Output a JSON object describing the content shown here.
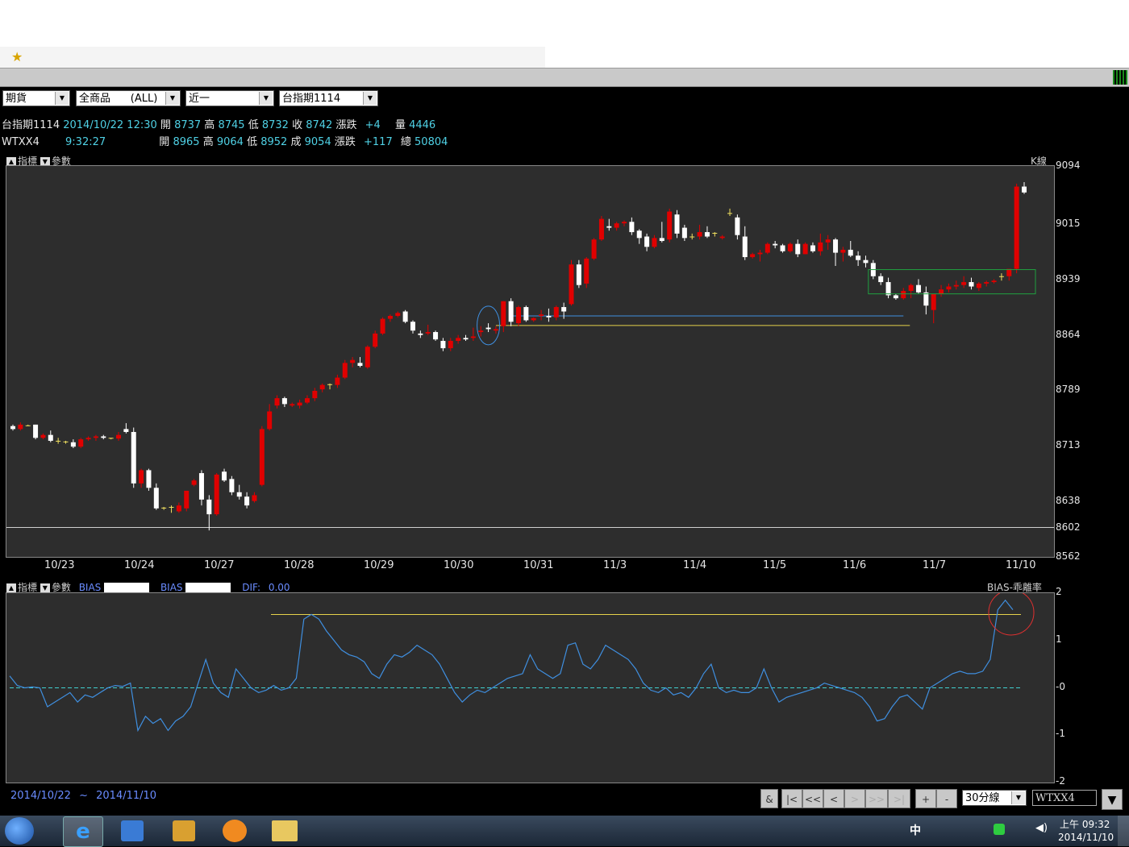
{
  "filters": {
    "market": "期貨",
    "products": "全商品      (ALL)",
    "period": "近一",
    "contract": "台指期1114"
  },
  "quote1": {
    "name": "台指期1114",
    "datetime": "2014/10/22 12:30",
    "open_lbl": "開",
    "open": "8737",
    "high_lbl": "高",
    "high": "8745",
    "low_lbl": "低",
    "low": "8732",
    "close_lbl": "收",
    "close": "8742",
    "chg_lbl": "漲跌",
    "chg": "+4",
    "vol_lbl": "量",
    "vol": "4446"
  },
  "quote2": {
    "name": "WTXX4",
    "time": "9:32:27",
    "open_lbl": "開",
    "open": "8965",
    "high_lbl": "高",
    "high": "9064",
    "low_lbl": "低",
    "low": "8952",
    "close_lbl": "成",
    "close": "9054",
    "chg_lbl": "漲跌",
    "chg": "+117",
    "vol_lbl": "總",
    "vol": "50804"
  },
  "main_panel": {
    "indicator_label": "指標",
    "param_label": "參數",
    "chart_label": "K線"
  },
  "bias_panel": {
    "indicator_label": "指標",
    "param_label": "參數",
    "bias_label1": "BIAS",
    "bias_label2": "BIAS",
    "dif_label": "DIF:",
    "dif_value": "0.00",
    "chart_label": "BIAS-乖離率"
  },
  "footer": {
    "range_start": "2014/10/22",
    "range_sep": "~",
    "range_end": "2014/11/10",
    "btn_amp": "&",
    "btn_first": "|<",
    "btn_prev_page": "<<",
    "btn_prev": "<",
    "btn_next": ">",
    "btn_next_page": ">>",
    "btn_last": ">|",
    "btn_plus": "+",
    "btn_minus": "-",
    "interval": "30分線",
    "symbol": "WTXX4"
  },
  "taskbar": {
    "clock_time": "上午 09:32",
    "clock_date": "2014/11/10",
    "ime": "中"
  },
  "colors": {
    "up": "#e00000",
    "down": "#ffffff",
    "flat": "#f0e060",
    "bias": "#3f8fe0",
    "zero": "#40d0d0",
    "refline": "#e6d24a",
    "blue_support": "#3f8fe0",
    "green_box": "#20a040",
    "red_circle": "#e03030"
  },
  "chart_data": [
    {
      "type": "candlestick",
      "title": "K線",
      "x_labels": [
        "10/23",
        "10/24",
        "10/27",
        "10/28",
        "10/29",
        "10/30",
        "10/31",
        "11/3",
        "11/4",
        "11/5",
        "11/6",
        "11/7",
        "11/10"
      ],
      "y_ticks": [
        9094,
        9015,
        8939,
        8864,
        8789,
        8713,
        8638,
        8602,
        8562
      ],
      "ylim": [
        8562,
        9094
      ],
      "horizontal_line": 8602,
      "ohlc": [
        [
          8740,
          8742,
          8734,
          8736
        ],
        [
          8736,
          8745,
          8734,
          8742
        ],
        [
          8740,
          8742,
          8740,
          8741
        ],
        [
          8742,
          8742,
          8722,
          8724
        ],
        [
          8724,
          8730,
          8722,
          8728
        ],
        [
          8728,
          8734,
          8718,
          8720
        ],
        [
          8720,
          8724,
          8716,
          8719
        ],
        [
          8719,
          8720,
          8716,
          8718
        ],
        [
          8718,
          8722,
          8710,
          8712
        ],
        [
          8712,
          8724,
          8710,
          8722
        ],
        [
          8722,
          8726,
          8720,
          8724
        ],
        [
          8724,
          8728,
          8720,
          8726
        ],
        [
          8726,
          8728,
          8722,
          8724
        ],
        [
          8724,
          8724,
          8722,
          8723
        ],
        [
          8723,
          8732,
          8720,
          8728
        ],
        [
          8736,
          8744,
          8730,
          8732
        ],
        [
          8732,
          8738,
          8656,
          8662
        ],
        [
          8662,
          8682,
          8656,
          8680
        ],
        [
          8680,
          8682,
          8652,
          8656
        ],
        [
          8656,
          8662,
          8626,
          8628
        ],
        [
          8628,
          8630,
          8626,
          8629
        ],
        [
          8629,
          8632,
          8622,
          8630
        ],
        [
          8624,
          8636,
          8622,
          8632
        ],
        [
          8628,
          8652,
          8624,
          8652
        ],
        [
          8660,
          8668,
          8658,
          8666
        ],
        [
          8676,
          8680,
          8632,
          8640
        ],
        [
          8640,
          8646,
          8598,
          8620
        ],
        [
          8620,
          8676,
          8618,
          8674
        ],
        [
          8678,
          8682,
          8664,
          8666
        ],
        [
          8668,
          8672,
          8646,
          8650
        ],
        [
          8650,
          8660,
          8640,
          8644
        ],
        [
          8644,
          8650,
          8628,
          8632
        ],
        [
          8638,
          8650,
          8636,
          8646
        ],
        [
          8660,
          8740,
          8658,
          8736
        ],
        [
          8736,
          8770,
          8734,
          8760
        ],
        [
          8768,
          8782,
          8764,
          8778
        ],
        [
          8778,
          8780,
          8766,
          8770
        ],
        [
          8768,
          8772,
          8766,
          8770
        ],
        [
          8768,
          8776,
          8764,
          8772
        ],
        [
          8772,
          8782,
          8770,
          8778
        ],
        [
          8778,
          8792,
          8774,
          8788
        ],
        [
          8790,
          8798,
          8786,
          8796
        ],
        [
          8796,
          8798,
          8790,
          8797
        ],
        [
          8796,
          8810,
          8792,
          8806
        ],
        [
          8806,
          8830,
          8804,
          8826
        ],
        [
          8826,
          8834,
          8820,
          8830
        ],
        [
          8826,
          8834,
          8820,
          8822
        ],
        [
          8820,
          8850,
          8818,
          8848
        ],
        [
          8848,
          8870,
          8846,
          8866
        ],
        [
          8866,
          8888,
          8864,
          8886
        ],
        [
          8886,
          8892,
          8882,
          8890
        ],
        [
          8890,
          8896,
          8888,
          8894
        ],
        [
          8896,
          8898,
          8880,
          8882
        ],
        [
          8882,
          8884,
          8866,
          8870
        ],
        [
          8866,
          8870,
          8860,
          8864
        ],
        [
          8866,
          8878,
          8864,
          8868
        ],
        [
          8868,
          8870,
          8856,
          8858
        ],
        [
          8856,
          8860,
          8842,
          8846
        ],
        [
          8846,
          8860,
          8842,
          8856
        ],
        [
          8856,
          8864,
          8852,
          8860
        ],
        [
          8860,
          8864,
          8856,
          8858
        ],
        [
          8860,
          8874,
          8856,
          8862
        ],
        [
          8868,
          8876,
          8862,
          8870
        ],
        [
          8874,
          8880,
          8868,
          8872
        ],
        [
          8870,
          8876,
          8866,
          8872
        ],
        [
          8876,
          8910,
          8868,
          8910
        ],
        [
          8910,
          8914,
          8876,
          8882
        ],
        [
          8880,
          8904,
          8876,
          8902
        ],
        [
          8902,
          8904,
          8882,
          8884
        ],
        [
          8884,
          8888,
          8882,
          8887
        ],
        [
          8890,
          8898,
          8884,
          8892
        ],
        [
          8890,
          8900,
          8882,
          8888
        ],
        [
          8888,
          8904,
          8884,
          8902
        ],
        [
          8902,
          8908,
          8886,
          8896
        ],
        [
          8906,
          8966,
          8904,
          8960
        ],
        [
          8960,
          8966,
          8928,
          8932
        ],
        [
          8934,
          8970,
          8928,
          8968
        ],
        [
          8968,
          8996,
          8966,
          8994
        ],
        [
          8994,
          9026,
          8992,
          9022
        ],
        [
          9012,
          9022,
          9006,
          9010
        ],
        [
          9010,
          9018,
          9006,
          9016
        ],
        [
          9016,
          9020,
          9012,
          9018
        ],
        [
          9018,
          9024,
          9000,
          9004
        ],
        [
          9006,
          9008,
          8988,
          8996
        ],
        [
          8998,
          9002,
          8978,
          8984
        ],
        [
          8984,
          9000,
          8982,
          8996
        ],
        [
          8996,
          9018,
          8990,
          8992
        ],
        [
          8994,
          9036,
          8990,
          9032
        ],
        [
          9028,
          9034,
          8996,
          9002
        ],
        [
          9010,
          9014,
          8992,
          8996
        ],
        [
          8998,
          9002,
          8994,
          8998
        ],
        [
          8998,
          9014,
          8994,
          9004
        ],
        [
          9004,
          9012,
          8996,
          8998
        ],
        [
          9002,
          9004,
          8998,
          9003
        ],
        [
          8996,
          9000,
          8994,
          8998
        ],
        [
          9030,
          9036,
          9026,
          9030
        ],
        [
          9024,
          9028,
          8994,
          9000
        ],
        [
          8998,
          9012,
          8966,
          8970
        ],
        [
          8970,
          8976,
          8968,
          8974
        ],
        [
          8974,
          8980,
          8964,
          8976
        ],
        [
          8976,
          8990,
          8974,
          8988
        ],
        [
          8988,
          8992,
          8982,
          8986
        ],
        [
          8986,
          8988,
          8976,
          8978
        ],
        [
          8978,
          8990,
          8976,
          8988
        ],
        [
          8988,
          8994,
          8970,
          8974
        ],
        [
          8974,
          8990,
          8974,
          8988
        ],
        [
          8986,
          8990,
          8976,
          8978
        ],
        [
          8978,
          9002,
          8972,
          8990
        ],
        [
          8990,
          9000,
          8980,
          8994
        ],
        [
          8994,
          8996,
          8958,
          8976
        ],
        [
          8976,
          8984,
          8964,
          8980
        ],
        [
          8980,
          8992,
          8970,
          8972
        ],
        [
          8972,
          8978,
          8958,
          8966
        ],
        [
          8966,
          8972,
          8956,
          8962
        ],
        [
          8962,
          8966,
          8940,
          8944
        ],
        [
          8944,
          8948,
          8932,
          8936
        ],
        [
          8936,
          8942,
          8914,
          8918
        ],
        [
          8918,
          8920,
          8912,
          8914
        ],
        [
          8914,
          8928,
          8912,
          8924
        ],
        [
          8924,
          8934,
          8914,
          8932
        ],
        [
          8932,
          8940,
          8920,
          8922
        ],
        [
          8922,
          8930,
          8892,
          8904
        ],
        [
          8898,
          8920,
          8880,
          8920
        ],
        [
          8920,
          8932,
          8916,
          8926
        ],
        [
          8926,
          8934,
          8922,
          8930
        ],
        [
          8930,
          8938,
          8926,
          8932
        ],
        [
          8932,
          8944,
          8928,
          8936
        ],
        [
          8936,
          8942,
          8926,
          8930
        ],
        [
          8928,
          8936,
          8924,
          8934
        ],
        [
          8934,
          8938,
          8930,
          8936
        ],
        [
          8936,
          8940,
          8934,
          8938
        ],
        [
          8944,
          8948,
          8938,
          8944
        ],
        [
          8944,
          8952,
          8938,
          8954
        ],
        [
          8954,
          9070,
          8948,
          9066
        ],
        [
          9066,
          9072,
          9056,
          9058
        ]
      ],
      "annotations": [
        "yellow support line at 8877",
        "blue support line at 8890",
        "green rectangle 11/7–11/10 ~8920–8953",
        "blue circle near 10/30 end",
        "red circle near latest bias peak"
      ]
    },
    {
      "type": "line",
      "title": "BIAS-乖離率",
      "y_ticks": [
        "2",
        "1",
        "-0",
        "-1",
        "-2"
      ],
      "ylim": [
        -2,
        2
      ],
      "reference_line": 1.55,
      "zero_line": 0,
      "series": [
        {
          "values": [
            0.25,
            0.05,
            0.0,
            0.02,
            0.0,
            -0.4,
            -0.3,
            -0.2,
            -0.1,
            -0.3,
            -0.15,
            -0.2,
            -0.1,
            0.0,
            0.05,
            0.03,
            0.1,
            -0.9,
            -0.6,
            -0.75,
            -0.65,
            -0.9,
            -0.7,
            -0.6,
            -0.4,
            0.1,
            0.6,
            0.1,
            -0.1,
            -0.2,
            0.4,
            0.2,
            0.0,
            -0.1,
            -0.05,
            0.05,
            -0.05,
            0.0,
            0.2,
            1.45,
            1.55,
            1.45,
            1.2,
            1.0,
            0.8,
            0.7,
            0.65,
            0.55,
            0.3,
            0.2,
            0.5,
            0.7,
            0.65,
            0.75,
            0.9,
            0.8,
            0.7,
            0.5,
            0.2,
            -0.1,
            -0.3,
            -0.15,
            -0.05,
            -0.1,
            0.0,
            0.1,
            0.2,
            0.25,
            0.3,
            0.7,
            0.4,
            0.3,
            0.2,
            0.3,
            0.9,
            0.95,
            0.5,
            0.4,
            0.6,
            0.9,
            0.8,
            0.7,
            0.6,
            0.4,
            0.1,
            -0.05,
            -0.1,
            0.0,
            -0.15,
            -0.1,
            -0.2,
            0.0,
            0.3,
            0.5,
            0.0,
            -0.1,
            -0.05,
            -0.1,
            -0.1,
            0.0,
            0.4,
            0.0,
            -0.3,
            -0.2,
            -0.15,
            -0.1,
            -0.05,
            0.0,
            0.1,
            0.05,
            0.0,
            -0.05,
            -0.1,
            -0.2,
            -0.4,
            -0.7,
            -0.65,
            -0.4,
            -0.2,
            -0.15,
            -0.3,
            -0.45,
            0.0,
            0.1,
            0.2,
            0.3,
            0.35,
            0.3,
            0.3,
            0.35,
            0.6,
            1.65,
            1.85,
            1.65
          ]
        }
      ]
    }
  ]
}
